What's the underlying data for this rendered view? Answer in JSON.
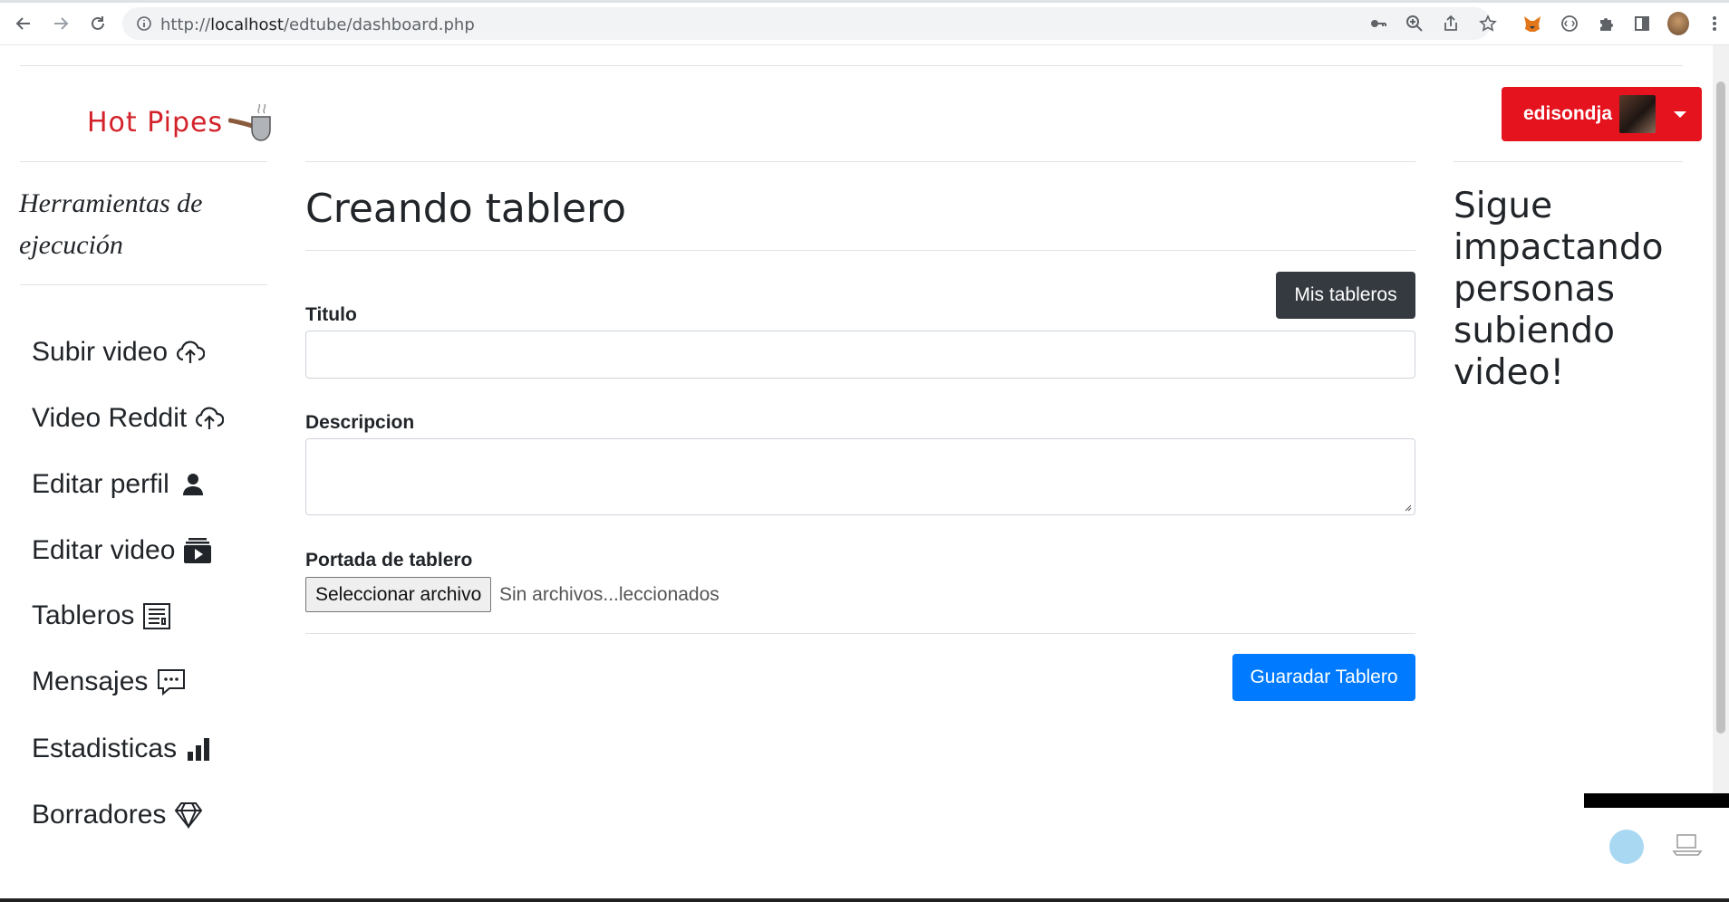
{
  "browser": {
    "url_prefix": "http://",
    "url_host": "localhost",
    "url_path": "/edtube/dashboard.php"
  },
  "header": {
    "logo_text": "Hot Pipes",
    "user_name": "edisondja"
  },
  "sidebar": {
    "title": "Herramientas de ejecución",
    "items": [
      {
        "label": "Subir video",
        "icon": "cloud-upload-icon"
      },
      {
        "label": "Video Reddit",
        "icon": "cloud-upload-icon"
      },
      {
        "label": "Editar perfil",
        "icon": "person-icon"
      },
      {
        "label": "Editar video",
        "icon": "video-collection-icon"
      },
      {
        "label": "Tableros",
        "icon": "board-icon"
      },
      {
        "label": "Mensajes",
        "icon": "chat-icon"
      },
      {
        "label": "Estadisticas",
        "icon": "bar-chart-icon"
      },
      {
        "label": "Borradores",
        "icon": "gem-icon"
      }
    ]
  },
  "main": {
    "title": "Creando tablero",
    "my_boards_button": "Mis tableros",
    "title_label": "Titulo",
    "title_value": "",
    "description_label": "Descripcion",
    "description_value": "",
    "cover_label": "Portada de tablero",
    "file_button": "Seleccionar archivo",
    "file_status": "Sin archivos...leccionados",
    "save_button": "Guaradar Tablero"
  },
  "aside": {
    "message": "Sigue impactando personas subiendo video!"
  },
  "colors": {
    "brand_red": "#e5131e",
    "primary": "#007bff",
    "dark": "#343a40"
  }
}
